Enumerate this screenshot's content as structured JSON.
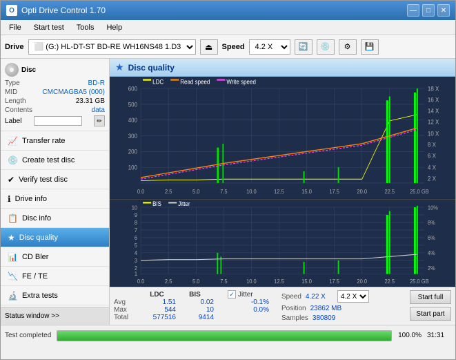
{
  "app": {
    "title": "Opti Drive Control 1.70",
    "icon": "O"
  },
  "titlebar": {
    "minimize": "—",
    "maximize": "□",
    "close": "✕"
  },
  "menubar": {
    "items": [
      "File",
      "Start test",
      "Tools",
      "Help"
    ]
  },
  "drivebar": {
    "drive_label": "Drive",
    "drive_value": "(G:)  HL-DT-ST BD-RE  WH16NS48 1.D3",
    "speed_label": "Speed",
    "speed_value": "4.2 X"
  },
  "disc": {
    "section_label": "Disc",
    "type_label": "Type",
    "type_value": "BD-R",
    "mid_label": "MID",
    "mid_value": "CMCMAGBA5 (000)",
    "length_label": "Length",
    "length_value": "23.31 GB",
    "contents_label": "Contents",
    "contents_value": "data",
    "label_label": "Label"
  },
  "sidebar": {
    "items": [
      {
        "id": "transfer-rate",
        "label": "Transfer rate",
        "icon": "📈"
      },
      {
        "id": "create-test-disc",
        "label": "Create test disc",
        "icon": "💿"
      },
      {
        "id": "verify-test-disc",
        "label": "Verify test disc",
        "icon": "✔"
      },
      {
        "id": "drive-info",
        "label": "Drive info",
        "icon": "ℹ"
      },
      {
        "id": "disc-info",
        "label": "Disc info",
        "icon": "📋"
      },
      {
        "id": "disc-quality",
        "label": "Disc quality",
        "icon": "★",
        "active": true
      },
      {
        "id": "cd-bler",
        "label": "CD Bler",
        "icon": "📊"
      },
      {
        "id": "fe-te",
        "label": "FE / TE",
        "icon": "📉"
      },
      {
        "id": "extra-tests",
        "label": "Extra tests",
        "icon": "🔬"
      }
    ],
    "status_window": "Status window >>"
  },
  "content": {
    "title": "Disc quality",
    "icon": "★"
  },
  "chart_upper": {
    "legend": [
      {
        "label": "LDC",
        "color": "#ffff00"
      },
      {
        "label": "Read speed",
        "color": "#ff8800"
      },
      {
        "label": "Write speed",
        "color": "#ff00ff"
      }
    ],
    "y_axis": [
      "600",
      "500",
      "400",
      "300",
      "200",
      "100"
    ],
    "y_axis_right": [
      "18 X",
      "16 X",
      "14 X",
      "12 X",
      "10 X",
      "8 X",
      "6 X",
      "4 X",
      "2 X"
    ],
    "x_axis": [
      "0.0",
      "2.5",
      "5.0",
      "7.5",
      "10.0",
      "12.5",
      "15.0",
      "17.5",
      "20.0",
      "22.5",
      "25.0 GB"
    ]
  },
  "chart_lower": {
    "legend": [
      {
        "label": "BIS",
        "color": "#ffff00"
      },
      {
        "label": "Jitter",
        "color": "#cccccc"
      }
    ],
    "y_axis": [
      "10",
      "9",
      "8",
      "7",
      "6",
      "5",
      "4",
      "3",
      "2",
      "1"
    ],
    "y_axis_right": [
      "10%",
      "8%",
      "6%",
      "4%",
      "2%"
    ],
    "x_axis": [
      "0.0",
      "2.5",
      "5.0",
      "7.5",
      "10.0",
      "12.5",
      "15.0",
      "17.5",
      "20.0",
      "22.5",
      "25.0 GB"
    ]
  },
  "stats": {
    "ldc_header": "LDC",
    "bis_header": "BIS",
    "jitter_label": "Jitter",
    "avg_label": "Avg",
    "max_label": "Max",
    "total_label": "Total",
    "ldc_avg": "1.51",
    "ldc_max": "544",
    "ldc_total": "577516",
    "bis_avg": "0.02",
    "bis_max": "10",
    "bis_total": "9414",
    "jitter_avg": "-0.1%",
    "jitter_max": "0.0%",
    "jitter_total": "",
    "speed_label": "Speed",
    "speed_value": "4.22 X",
    "position_label": "Position",
    "position_value": "23862 MB",
    "samples_label": "Samples",
    "samples_value": "380809",
    "speed_select": "4.2 X",
    "start_full": "Start full",
    "start_part": "Start part",
    "jitter_checked": true
  },
  "statusbar": {
    "test_completed": "Test completed",
    "progress": "100.0%",
    "time": "31:31"
  }
}
